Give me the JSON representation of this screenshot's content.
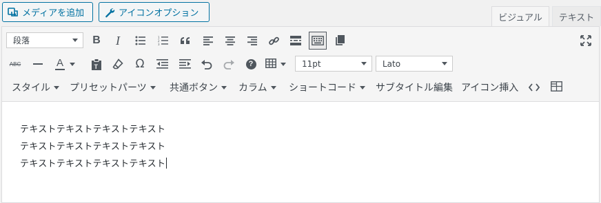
{
  "header": {
    "add_media": "メディアを追加",
    "icon_options": "アイコンオプション",
    "tab_visual": "ビジュアル",
    "tab_text": "テキスト"
  },
  "toolbar": {
    "format_select": "段落",
    "font_size_select": "11pt",
    "font_family_select": "Lato",
    "row1_icons": [
      "bold-icon",
      "italic-icon",
      "bullet-list-icon",
      "numbered-list-icon",
      "blockquote-icon",
      "align-left-icon",
      "align-center-icon",
      "align-right-icon",
      "link-icon",
      "read-more-icon",
      "toolbar-toggle-icon",
      "pages-icon",
      "fullscreen-icon"
    ],
    "row2_icons": [
      "strikethrough-icon",
      "horizontal-line-icon",
      "text-color-icon",
      "paste-as-text-icon",
      "clear-formatting-icon",
      "special-character-icon",
      "outdent-icon",
      "indent-icon",
      "undo-icon",
      "redo-icon",
      "help-icon",
      "table-icon"
    ],
    "menus": {
      "style": "スタイル",
      "preset_parts": "プリセットパーツ",
      "common_button": "共通ボタン",
      "column": "カラム",
      "shortcode": "ショートコード",
      "subtitle_edit": "サブタイトル編集",
      "icon_insert": "アイコン挿入"
    },
    "bold_label": "B",
    "italic_label": "I",
    "strike_label": "ABC",
    "text_color_label": "A",
    "omega_label": "Ω",
    "help_label": "?"
  },
  "content": {
    "lines": [
      "テキストテキストテキストテキスト",
      "テキストテキストテキストテキスト",
      "テキストテキストテキストテキスト"
    ]
  },
  "colors": {
    "accent": "#0071a1",
    "toolbar_bg": "#f5f5f5",
    "icon": "#50575e"
  }
}
